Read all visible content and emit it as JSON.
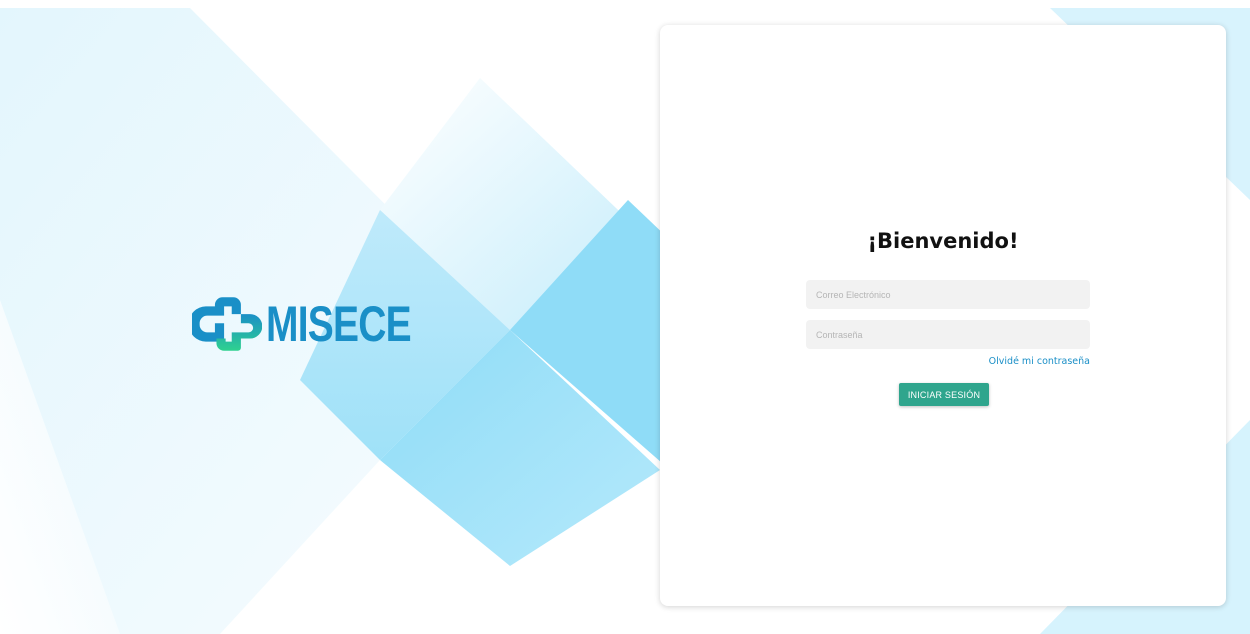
{
  "brand": {
    "name": "MISECE",
    "logo_icon": "medical-cross-icon",
    "colors": {
      "primary_blue": "#1a8fc7",
      "accent_green": "#2fd18f",
      "button_teal": "#2fa58d"
    }
  },
  "login": {
    "title": "¡Bienvenido!",
    "email_placeholder": "Correo Electrónico",
    "email_value": "",
    "password_placeholder": "Contraseña",
    "password_value": "",
    "forgot_label": "Olvidé mi contraseña",
    "submit_label": "INICIAR SESIÓN"
  }
}
